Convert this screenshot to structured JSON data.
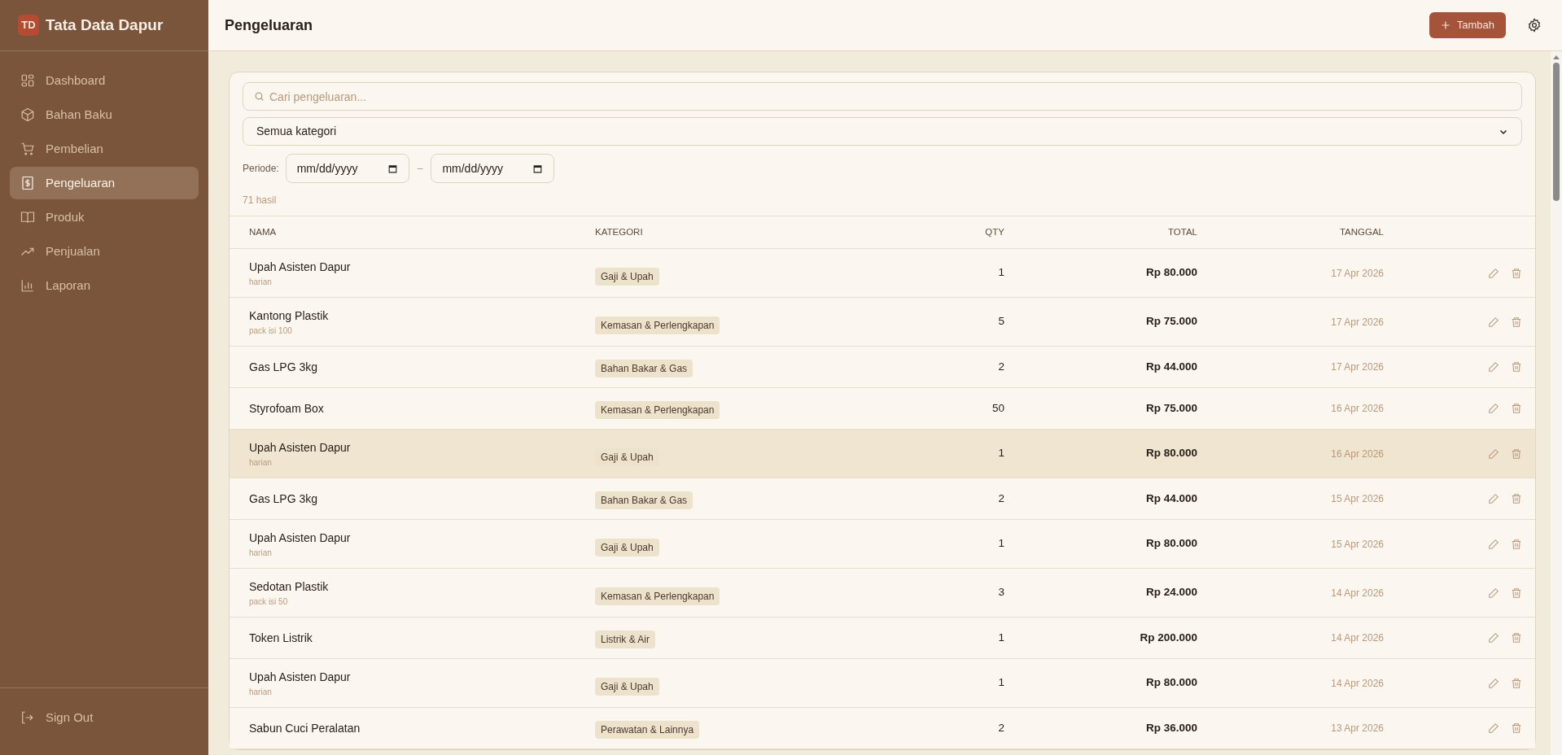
{
  "app": {
    "logo": "TD",
    "name": "Tata Data Dapur"
  },
  "sidebar": {
    "items": [
      {
        "label": "Dashboard",
        "selected": false
      },
      {
        "label": "Bahan Baku",
        "selected": false
      },
      {
        "label": "Pembelian",
        "selected": false
      },
      {
        "label": "Pengeluaran",
        "selected": true
      },
      {
        "label": "Produk",
        "selected": false
      },
      {
        "label": "Penjualan",
        "selected": false
      },
      {
        "label": "Laporan",
        "selected": false
      }
    ],
    "sign_out": "Sign Out"
  },
  "header": {
    "title": "Pengeluaran",
    "add_button": "Tambah"
  },
  "filters": {
    "search_placeholder": "Cari pengeluaran...",
    "category": "Semua kategori",
    "period_label": "Periode:",
    "date_from": "mm/dd/yyyy",
    "separator": "–",
    "date_to": "mm/dd/yyyy",
    "result_count": "71 hasil"
  },
  "table": {
    "columns": [
      "NAMA",
      "KATEGORI",
      "QTY",
      "TOTAL",
      "TANGGAL"
    ],
    "rows": [
      {
        "name": "Upah Asisten Dapur",
        "note": "harian",
        "category": "Gaji & Upah",
        "qty": "1",
        "total": "Rp 80.000",
        "date": "17 Apr 2026",
        "highlighted": false
      },
      {
        "name": "Kantong Plastik",
        "note": "pack isi 100",
        "category": "Kemasan & Perlengkapan",
        "qty": "5",
        "total": "Rp 75.000",
        "date": "17 Apr 2026",
        "highlighted": false
      },
      {
        "name": "Gas LPG 3kg",
        "category": "Bahan Bakar & Gas",
        "qty": "2",
        "total": "Rp 44.000",
        "date": "17 Apr 2026",
        "highlighted": false
      },
      {
        "name": "Styrofoam Box",
        "category": "Kemasan & Perlengkapan",
        "qty": "50",
        "total": "Rp 75.000",
        "date": "16 Apr 2026",
        "highlighted": false
      },
      {
        "name": "Upah Asisten Dapur",
        "note": "harian",
        "category": "Gaji & Upah",
        "qty": "1",
        "total": "Rp 80.000",
        "date": "16 Apr 2026",
        "highlighted": true
      },
      {
        "name": "Gas LPG 3kg",
        "category": "Bahan Bakar & Gas",
        "qty": "2",
        "total": "Rp 44.000",
        "date": "15 Apr 2026",
        "highlighted": false
      },
      {
        "name": "Upah Asisten Dapur",
        "note": "harian",
        "category": "Gaji & Upah",
        "qty": "1",
        "total": "Rp 80.000",
        "date": "15 Apr 2026",
        "highlighted": false
      },
      {
        "name": "Sedotan Plastik",
        "note": "pack isi 50",
        "category": "Kemasan & Perlengkapan",
        "qty": "3",
        "total": "Rp 24.000",
        "date": "14 Apr 2026",
        "highlighted": false
      },
      {
        "name": "Token Listrik",
        "category": "Listrik & Air",
        "qty": "1",
        "total": "Rp 200.000",
        "date": "14 Apr 2026",
        "highlighted": false
      },
      {
        "name": "Upah Asisten Dapur",
        "note": "harian",
        "category": "Gaji & Upah",
        "qty": "1",
        "total": "Rp 80.000",
        "date": "14 Apr 2026",
        "highlighted": false
      },
      {
        "name": "Sabun Cuci Peralatan",
        "category": "Perawatan & Lainnya",
        "qty": "2",
        "total": "Rp 36.000",
        "date": "13 Apr 2026",
        "highlighted": false
      }
    ]
  }
}
